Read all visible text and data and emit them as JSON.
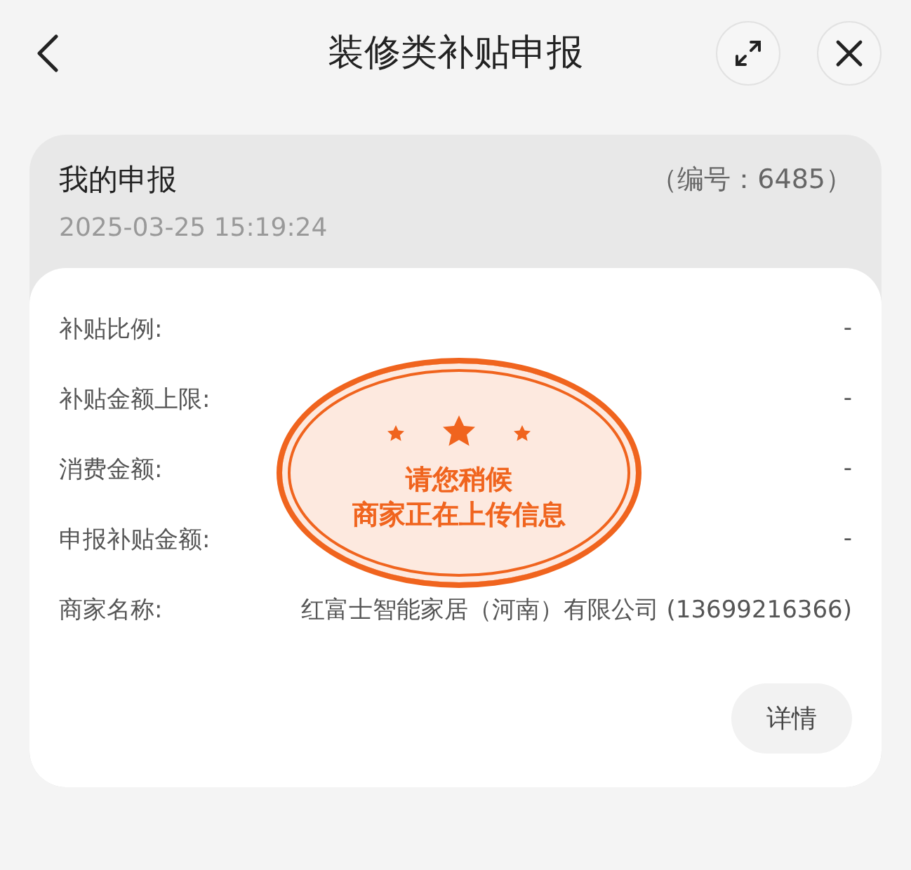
{
  "header": {
    "title": "装修类补贴申报"
  },
  "card": {
    "title": "我的申报",
    "number": "（编号：6485）",
    "time": "2025-03-25 15:19:24",
    "rows": [
      {
        "label": "补贴比例:",
        "value": "-"
      },
      {
        "label": "补贴金额上限:",
        "value": "-"
      },
      {
        "label": "消费金额:",
        "value": "-"
      },
      {
        "label": "申报补贴金额:",
        "value": "-"
      },
      {
        "label": "商家名称:",
        "value": "红富士智能家居（河南）有限公司 (13699216366)"
      }
    ],
    "details_button": "详情"
  },
  "stamp": {
    "lines": [
      "请您稍候",
      "商家正在上传信息"
    ]
  }
}
